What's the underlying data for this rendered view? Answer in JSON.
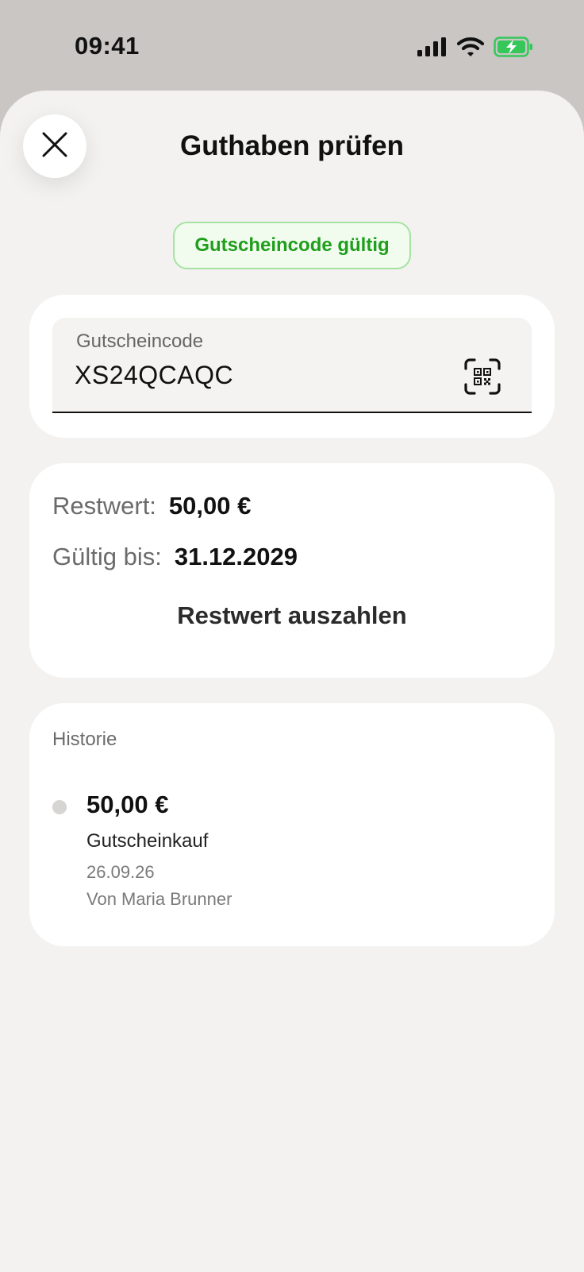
{
  "status_bar": {
    "time": "09:41",
    "icons": [
      "signal-icon",
      "wifi-icon",
      "battery-charging-icon"
    ],
    "battery_color": "#35c759"
  },
  "sheet": {
    "title": "Guthaben prüfen",
    "close_icon": "close-icon"
  },
  "badge": {
    "text": "Gutscheincode gültig",
    "color": "#1e9e1b"
  },
  "voucher_input": {
    "label": "Gutscheincode",
    "value": "XS24QCAQC",
    "scan_icon": "qr-scan-icon"
  },
  "balance": {
    "remaining_label": "Restwert:",
    "remaining_value": "50,00 €",
    "valid_label": "Gültig bis:",
    "valid_value": "31.12.2029",
    "payout_label": "Restwert auszahlen"
  },
  "history": {
    "title": "Historie",
    "items": [
      {
        "amount": "50,00 €",
        "type": "Gutscheinkauf",
        "date": "26.09.26",
        "from": "Von Maria Brunner"
      }
    ]
  }
}
